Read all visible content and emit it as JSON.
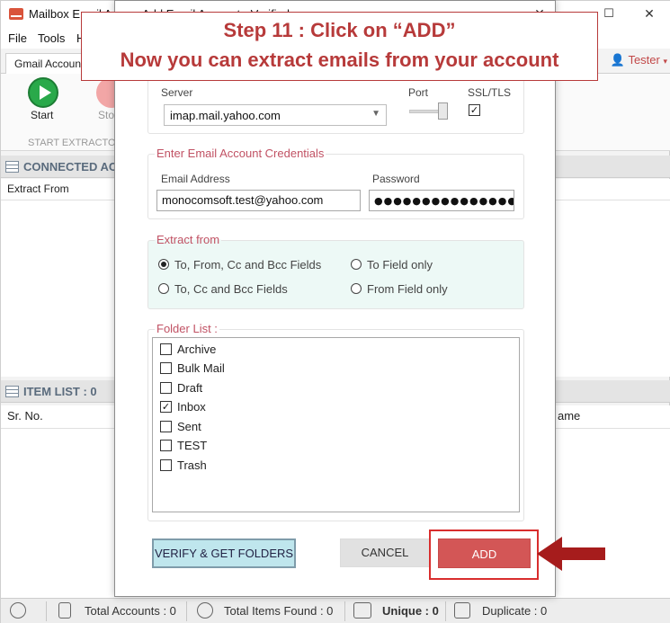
{
  "window": {
    "title": "Mailbox Email Ad",
    "dialog_title": "Add Email Account - Verified",
    "minimize": "–",
    "maximize": "☐",
    "close": "✕"
  },
  "menu": {
    "file": "File",
    "tools": "Tools",
    "help": "H"
  },
  "ribbon": {
    "tab": "Gmail Account",
    "start": "Start",
    "stop": "Sto",
    "group": "START EXTRACTO",
    "user": "Tester"
  },
  "panels": {
    "connected": "CONNECTED AC",
    "extract_from": "Extract From",
    "item_list": "ITEM LIST : 0",
    "sr_no": "Sr. No.",
    "name_col": "ame"
  },
  "status": {
    "total_accounts": "Total Accounts : 0",
    "total_items": "Total Items Found : 0",
    "unique": "Unique : 0",
    "duplicate": "Duplicate : 0"
  },
  "callout": {
    "line1": "Step 11 : Click on “ADD”",
    "line2": "Now you can extract emails from your account"
  },
  "dialog": {
    "server_label": "Server",
    "server_value": "imap.mail.yahoo.com",
    "port_label": "Port",
    "ssl_label": "SSL/TLS",
    "ssl_checked": "✓",
    "credentials_title": "Enter Email Account Credentials",
    "email_label": "Email Address",
    "email_value": "monocomsoft.test@yahoo.com",
    "password_label": "Password",
    "password_value": "●●●●●●●●●●●●●●●●●",
    "extract_title": "Extract from",
    "options": [
      "To, From, Cc and Bcc Fields",
      "To Field only",
      "To, Cc and Bcc Fields",
      "From Field only"
    ],
    "folder_title": "Folder List :",
    "folders": [
      {
        "name": "Archive",
        "mark": ""
      },
      {
        "name": "Bulk Mail",
        "mark": ""
      },
      {
        "name": "Draft",
        "mark": ""
      },
      {
        "name": "Inbox",
        "mark": "✓"
      },
      {
        "name": "Sent",
        "mark": ""
      },
      {
        "name": "TEST",
        "mark": ""
      },
      {
        "name": "Trash",
        "mark": ""
      }
    ],
    "verify_btn": "VERIFY & GET FOLDERS",
    "cancel_btn": "CANCEL",
    "add_btn": "ADD"
  },
  "colors": {
    "accent": "#b73a3a",
    "add": "#d35656",
    "verify": "#bfe6ed",
    "mint": "#edf9f6"
  }
}
